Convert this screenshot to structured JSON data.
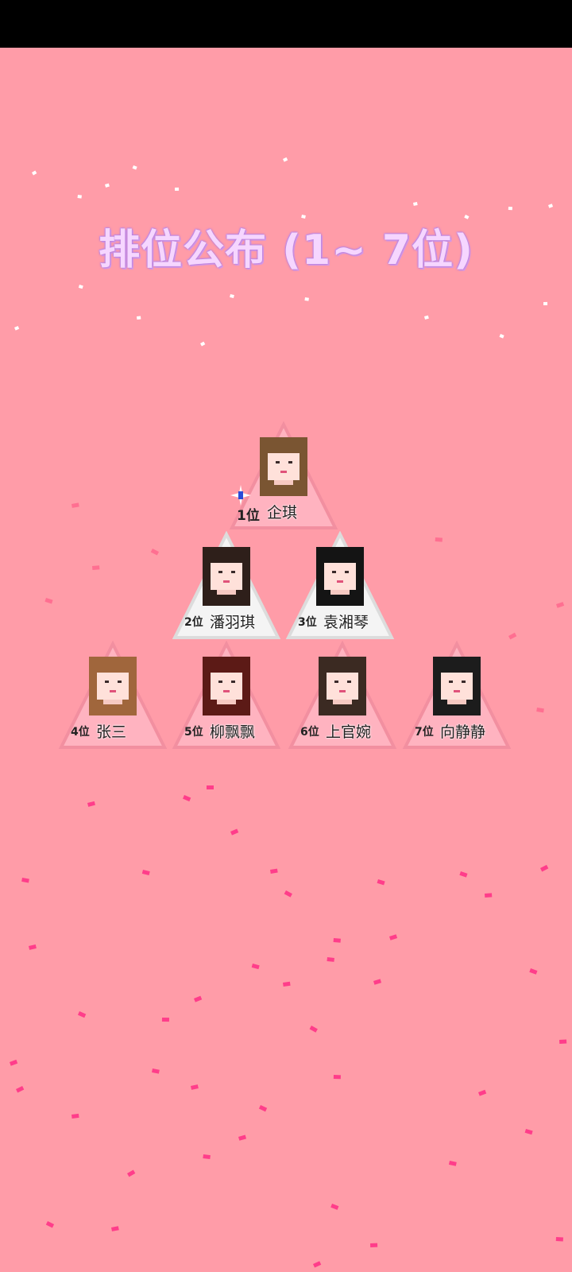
{
  "title": "排位公布 (1~ 7位)",
  "colors": {
    "background": "#ff9ca8",
    "title": "#f6d6ff",
    "card_pink": "#ffb3c0",
    "card_white": "#f4f4f4",
    "confetti": "#ff3d8a"
  },
  "podium": [
    {
      "rank_label": "1位",
      "name": "企琪",
      "hair": "#7a5532",
      "style": "pink",
      "sparkle": "sparkle-icon"
    },
    {
      "rank_label": "2位",
      "name": "潘羽琪",
      "hair": "#2e1f1a",
      "style": "white"
    },
    {
      "rank_label": "3位",
      "name": "袁湘琴",
      "hair": "#141414",
      "style": "white"
    },
    {
      "rank_label": "4位",
      "name": "张三",
      "hair": "#a0663c",
      "style": "pink"
    },
    {
      "rank_label": "5位",
      "name": "柳飘飘",
      "hair": "#5c1a16",
      "style": "pink"
    },
    {
      "rank_label": "6位",
      "name": "上官婉",
      "hair": "#3b2a22",
      "style": "pink"
    },
    {
      "rank_label": "7位",
      "name": "向静静",
      "hair": "#1c1c1c",
      "style": "pink"
    }
  ]
}
